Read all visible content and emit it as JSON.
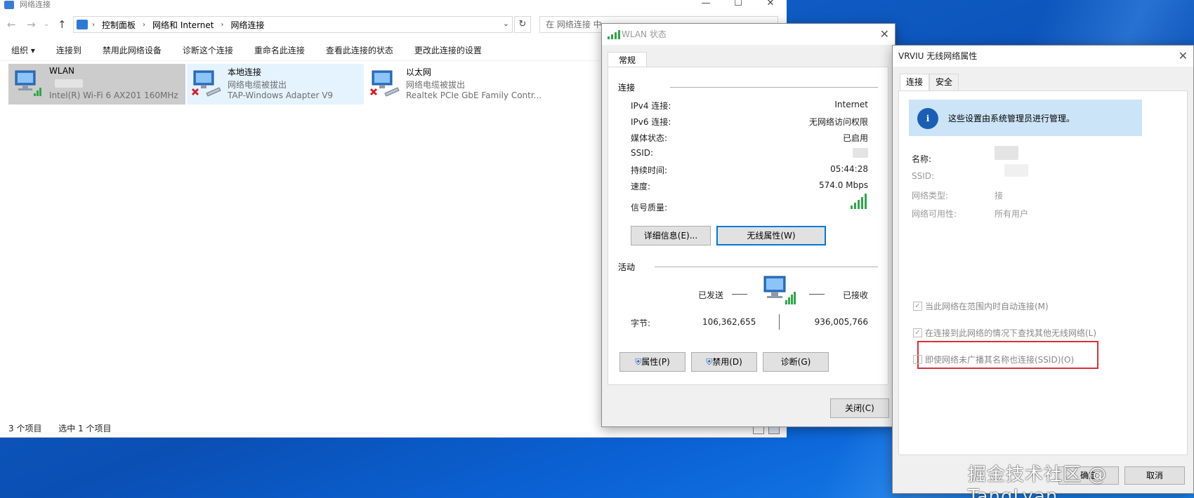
{
  "explorer": {
    "title": "网络连接",
    "breadcrumb": [
      "控制面板",
      "网络和 Internet",
      "网络连接"
    ],
    "search_placeholder": "在 网络连接 中",
    "commands": [
      "组织 ▾",
      "连接到",
      "禁用此网络设备",
      "诊断这个连接",
      "重命名此连接",
      "查看此连接的状态",
      "更改此连接的设置"
    ],
    "items": [
      {
        "name": "WLAN",
        "status": "",
        "device": "Intel(R) Wi-Fi 6 AX201 160MHz"
      },
      {
        "name": "本地连接",
        "status": "网络电缆被拔出",
        "device": "TAP-Windows Adapter V9"
      },
      {
        "name": "以太网",
        "status": "网络电缆被拔出",
        "device": "Realtek PCIe GbE Family Contr..."
      }
    ],
    "status_count": "3 个项目",
    "status_selected": "选中 1 个项目"
  },
  "wlan_status": {
    "title": "WLAN 状态",
    "tab": "常规",
    "group_connection": "连接",
    "rows": [
      {
        "label": "IPv4 连接:",
        "value": "Internet"
      },
      {
        "label": "IPv6 连接:",
        "value": "无网络访问权限"
      },
      {
        "label": "媒体状态:",
        "value": "已启用"
      },
      {
        "label": "SSID:",
        "value": ""
      },
      {
        "label": "持续时间:",
        "value": "05:44:28"
      },
      {
        "label": "速度:",
        "value": "574.0 Mbps"
      },
      {
        "label": "信号质量:",
        "value": ""
      }
    ],
    "signal_bars": 5,
    "btn_details": "详细信息(E)...",
    "btn_wireless": "无线属性(W)",
    "group_activity": "活动",
    "sent_label": "已发送",
    "recv_label": "已接收",
    "bytes_label": "字节:",
    "bytes_sent": "106,362,655",
    "bytes_recv": "936,005,766",
    "btn_properties": "属性(P)",
    "btn_disable": "禁用(D)",
    "btn_diagnose": "诊断(G)",
    "btn_close": "关闭(C)"
  },
  "vrviu_props": {
    "title": "VRVIU 无线网络属性",
    "tabs": [
      "连接",
      "安全"
    ],
    "info": "这些设置由系统管理员进行管理。",
    "name_label": "名称:",
    "ssid_label": "SSID:",
    "type_label": "网络类型:",
    "type_value": "接",
    "avail_label": "网络可用性:",
    "avail_value": "所有用户",
    "chk1": "当此网络在范围内时自动连接(M)",
    "chk2": "在连接到此网络的情况下查找其他无线网络(L)",
    "chk3": "即使网络未广播其名称也连接(SSID)(O)",
    "btn_ok": "确定",
    "btn_cancel": "取消"
  },
  "watermark": "掘金技术社区 @ TangLyan"
}
